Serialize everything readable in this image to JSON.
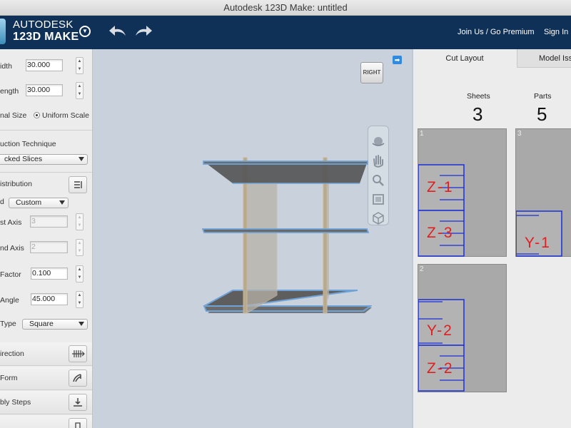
{
  "window": {
    "title": "Autodesk 123D Make: untitled"
  },
  "header": {
    "brand_top": "AUTODESK",
    "brand_bottom": "123D MAKE",
    "join_label": "Join Us / Go Premium",
    "signin_label": "Sign In"
  },
  "left_panel": {
    "width_label": "idth",
    "width_value": "30.000",
    "length_label": "ength",
    "length_value": "30.000",
    "size_label": "nal Size",
    "uniform_scale_label": "Uniform Scale",
    "technique_label": "uction Technique",
    "technique_value": "cked Slices",
    "distribution_label": "istribution",
    "method_label": "d",
    "method_value": "Custom",
    "first_axis_label": "st Axis",
    "first_axis_value": "3",
    "second_axis_label": "nd Axis",
    "second_axis_value": "2",
    "factor_label": "Factor",
    "factor_value": "0.100",
    "angle_label": "Angle",
    "angle_value": "45.000",
    "type_label": "Type",
    "type_value": "Square",
    "direction_label": "irection",
    "form_label": "Form",
    "steps_label": "bly Steps"
  },
  "viewport": {
    "viewcube_label": "RIGHT"
  },
  "right_panel": {
    "tabs": [
      "Cut Layout",
      "Model Issu"
    ],
    "sheets_label": "Sheets",
    "sheets_count": "3",
    "parts_label": "Parts",
    "parts_count": "5",
    "sheets": [
      {
        "id": "1",
        "parts": [
          "Z-1",
          "Z-3"
        ]
      },
      {
        "id": "3",
        "parts": [
          "Y-1"
        ]
      },
      {
        "id": "2",
        "parts": [
          "Y-2",
          "Z-2"
        ]
      }
    ]
  },
  "colors": {
    "header_bg": "#0f3057",
    "part_outline": "#1a2fd6",
    "part_label": "#e02020",
    "sheet_bg": "#a9a9a9"
  }
}
